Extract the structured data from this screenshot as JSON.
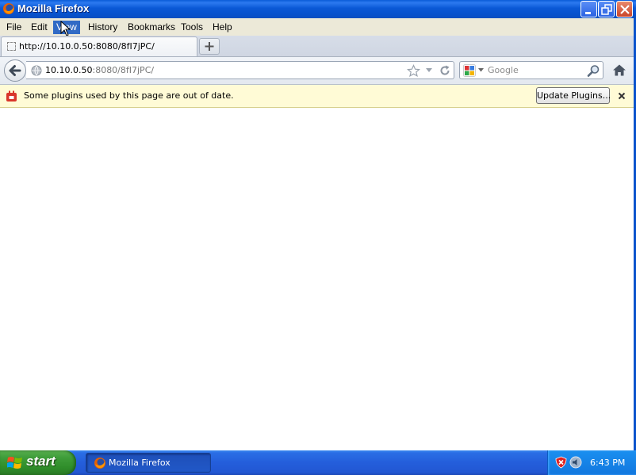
{
  "window": {
    "title": "Mozilla Firefox"
  },
  "menu": {
    "items": [
      "File",
      "Edit",
      "View",
      "History",
      "Bookmarks",
      "Tools",
      "Help"
    ],
    "active": "View"
  },
  "tabs": [
    {
      "label": "http://10.10.0.50:8080/8fI7jPC/"
    }
  ],
  "navbar": {
    "url_host": "10.10.0.50",
    "url_rest": ":8080/8fI7jPC/",
    "search_placeholder": "Google"
  },
  "notification": {
    "message": "Some plugins used by this page are out of date.",
    "button_label": "Update Plugins..."
  },
  "taskbar": {
    "start_label": "start",
    "task_label": "Mozilla Firefox",
    "clock": "6:43 PM"
  },
  "colors": {
    "titlebar": "#0a58d6",
    "menu_active": "#316ac5",
    "notification_bg": "#fffbd6",
    "taskbar": "#245edb",
    "start_green": "#3e9c39"
  }
}
